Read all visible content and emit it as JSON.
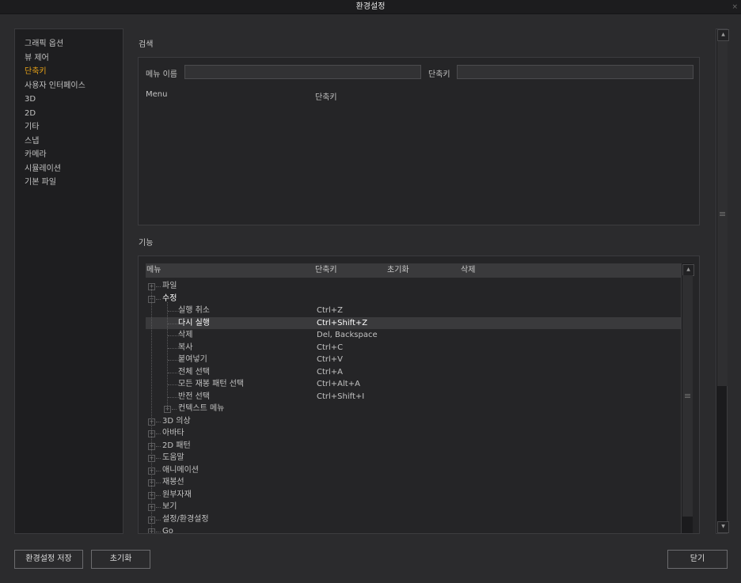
{
  "window": {
    "title": "환경설정",
    "close": "×"
  },
  "sidebar": {
    "items": [
      "그래픽 옵션",
      "뷰 제어",
      "단축키",
      "사용자 인터페이스",
      "3D",
      "2D",
      "기타",
      "스냅",
      "카메라",
      "시뮬레이션",
      "기본 파일"
    ]
  },
  "search": {
    "section_label": "검색",
    "menu_name_label": "메뉴 이름",
    "menu_name_value": "",
    "shortcut_label": "단축키",
    "shortcut_value": "",
    "col_menu": "Menu",
    "col_shortcut": "단축키"
  },
  "functions": {
    "section_label": "기능",
    "columns": [
      "메뉴",
      "단축키",
      "초기화",
      "삭제"
    ],
    "tree": [
      {
        "name": "파일",
        "shortcut": "",
        "level": 0,
        "expander": "+"
      },
      {
        "name": "수정",
        "shortcut": "",
        "level": 0,
        "expander": "−",
        "bold": true
      },
      {
        "name": "실행 취소",
        "shortcut": "Ctrl+Z",
        "level": 1
      },
      {
        "name": "다시 실행",
        "shortcut": "Ctrl+Shift+Z",
        "level": 1,
        "selected": true
      },
      {
        "name": "삭제",
        "shortcut": "Del, Backspace",
        "level": 1
      },
      {
        "name": "복사",
        "shortcut": "Ctrl+C",
        "level": 1
      },
      {
        "name": "붙여넣기",
        "shortcut": "Ctrl+V",
        "level": 1
      },
      {
        "name": "전체 선택",
        "shortcut": "Ctrl+A",
        "level": 1
      },
      {
        "name": "모든 재봉 패턴 선택",
        "shortcut": "Ctrl+Alt+A",
        "level": 1
      },
      {
        "name": "반전 선택",
        "shortcut": "Ctrl+Shift+I",
        "level": 1
      },
      {
        "name": "컨텍스트 메뉴",
        "shortcut": "",
        "level": 1,
        "expander": "+"
      },
      {
        "name": "3D 의상",
        "shortcut": "",
        "level": 0,
        "expander": "+"
      },
      {
        "name": "아바타",
        "shortcut": "",
        "level": 0,
        "expander": "+"
      },
      {
        "name": "2D 패턴",
        "shortcut": "",
        "level": 0,
        "expander": "+"
      },
      {
        "name": "도움말",
        "shortcut": "",
        "level": 0,
        "expander": "+"
      },
      {
        "name": "애니메이션",
        "shortcut": "",
        "level": 0,
        "expander": "+"
      },
      {
        "name": "재봉선",
        "shortcut": "",
        "level": 0,
        "expander": "+"
      },
      {
        "name": "원부자재",
        "shortcut": "",
        "level": 0,
        "expander": "+"
      },
      {
        "name": "보기",
        "shortcut": "",
        "level": 0,
        "expander": "+"
      },
      {
        "name": "설정/환경설정",
        "shortcut": "",
        "level": 0,
        "expander": "+"
      },
      {
        "name": "Go",
        "shortcut": "",
        "level": 0,
        "expander": "+"
      }
    ]
  },
  "footer": {
    "save": "환경설정 저장",
    "reset": "초기화",
    "close": "닫기"
  },
  "icons": {
    "scroll_up": "▲",
    "scroll_down": "▼",
    "grip": "≡"
  },
  "colors": {
    "accent": "#e8a317",
    "background": "#2b2b2d",
    "panel": "#252527",
    "selected_row": "#3a3a3c"
  }
}
